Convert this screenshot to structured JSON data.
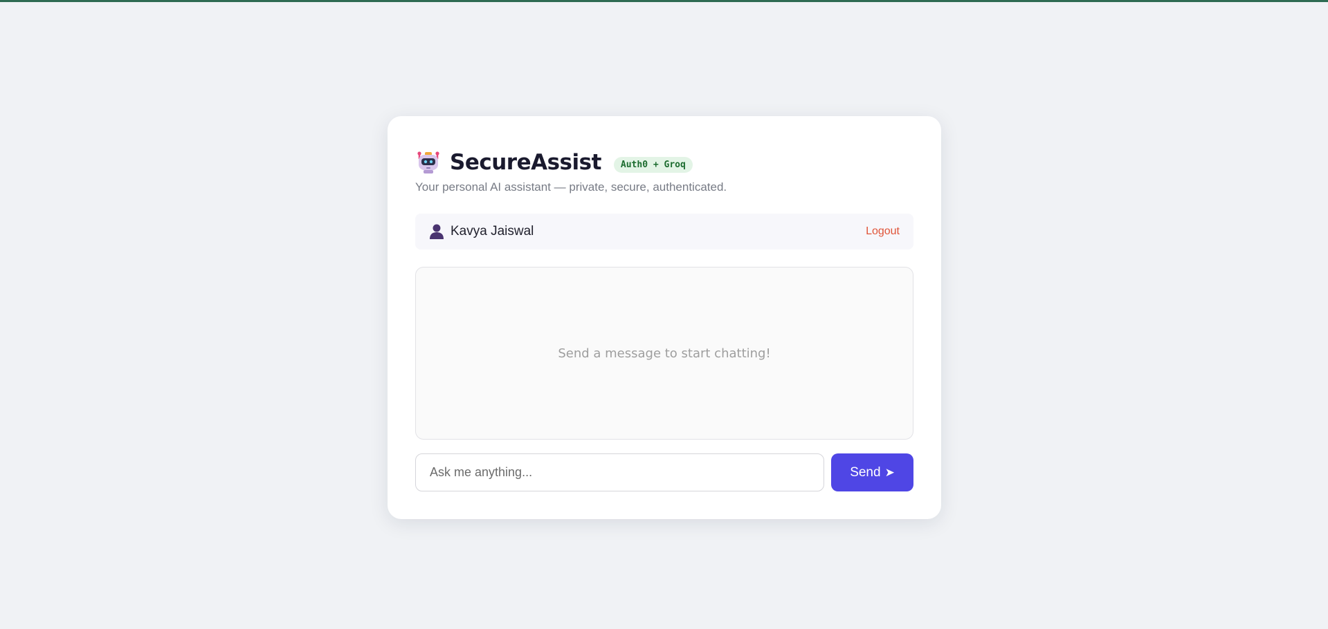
{
  "app": {
    "title": "SecureAssist",
    "badge": "Auth0 + Groq",
    "subtitle": "Your personal AI assistant — private, secure, authenticated.",
    "logo_icon": "robot-icon"
  },
  "user": {
    "name": "Kavya Jaiswal",
    "icon": "user-silhouette-icon",
    "logout_label": "Logout"
  },
  "chat": {
    "empty_message": "Send a message to start chatting!"
  },
  "composer": {
    "placeholder": "Ask me anything...",
    "send_label": "Send",
    "send_icon": "send-arrow-icon"
  },
  "colors": {
    "page_bg": "#f0f2f5",
    "accent": "#4f46e5",
    "logout": "#e05438",
    "badge_bg": "#e3f4e6",
    "badge_text": "#1b6b2e",
    "top_strip": "#2e6b52"
  }
}
